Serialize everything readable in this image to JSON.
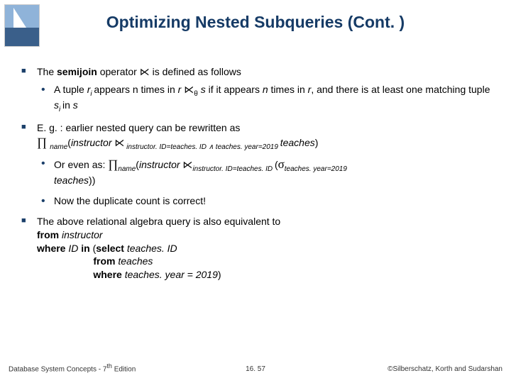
{
  "slide": {
    "title": "Optimizing Nested Subqueries (Cont. )",
    "bullets": {
      "b1_1_a": "The ",
      "b1_1_bold": "semijoin",
      "b1_1_b": " operator ⋉ is defined as follows",
      "b2_1_a": "A tuple ",
      "b2_1_ri": "r",
      "b2_1_i": "i ",
      "b2_1_b": "appears n times in ",
      "b2_1_r": "r",
      "b2_1_c": " ⋉",
      "b2_1_theta": "θ",
      "b2_1_d": " ",
      "b2_1_s": "s",
      "b2_1_e": " if it appears ",
      "b2_1_n": "n",
      "b2_1_f": " times in ",
      "b2_1_r2": "r",
      "b2_1_g": ", and there is at least one matching tuple ",
      "b2_1_si": "s",
      "b2_1_i2": "i ",
      "b2_1_h": "in ",
      "b2_1_s2": "s",
      "b1_2": "E. g. : earlier nested query can be rewritten as",
      "expr_pi": "∏ ",
      "expr_sub1": "name",
      "expr_a": "(",
      "expr_instr": "instructor",
      "expr_b": " ⋉",
      "expr_sub2": " instructor. ID=teaches. ID ∧ teaches. year=2019 ",
      "expr_teach": "teaches",
      "expr_c": ")",
      "b2_2_a": "Or even as:   ",
      "expr2_pi": "∏",
      "expr2_sub1": "name",
      "expr2_a": "(",
      "expr2_instr": "instructor",
      "expr2_b": " ⋉",
      "expr2_sub2": "instructor. ID=teaches. ID ",
      "expr2_c": "(",
      "expr2_sigma": "σ",
      "expr2_sub3": "teaches. year=2019",
      "expr2_teach": " teaches",
      "expr2_d": "))",
      "b2_3": "Now the duplicate count is correct!",
      "b1_3": "The above relational algebra query is also equivalent to",
      "sql_from1a": "from",
      "sql_from1b": " instructor",
      "sql_where1a": "where",
      "sql_where1b": " ID ",
      "sql_where1c": "in",
      "sql_where1d": " (",
      "sql_where1e": "select",
      "sql_where1f": " teaches. ID",
      "sql_from2a": "from",
      "sql_from2b": " teaches",
      "sql_where2a": "where",
      "sql_where2b": " teaches. year = 2019",
      "sql_where2c": ")"
    },
    "footer": {
      "left": "Database System Concepts - 7",
      "left_sup": "th",
      "left_b": " Edition",
      "center": "16. 57",
      "right": "©Silberschatz, Korth and Sudarshan"
    }
  }
}
